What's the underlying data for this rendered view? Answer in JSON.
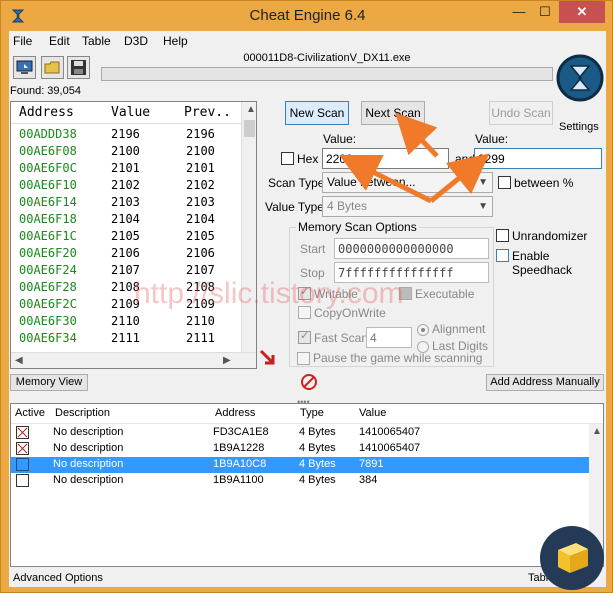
{
  "window": {
    "title": "Cheat Engine 6.4",
    "minimize_glyph": "—",
    "maximize_glyph": "☐",
    "close_glyph": "✕"
  },
  "menu": {
    "items": [
      "File",
      "Edit",
      "Table",
      "D3D",
      "Help"
    ]
  },
  "toolbar": {
    "process_name": "000011D8-CivilizationV_DX11.exe",
    "found": "Found: 39,054",
    "settings_label": "Settings"
  },
  "address_list": {
    "headers": {
      "address": "Address",
      "value": "Value",
      "previous": "Prev.."
    },
    "rows": [
      {
        "address": "00ADDD38",
        "value": "2196",
        "previous": "2196"
      },
      {
        "address": "00AE6F08",
        "value": "2100",
        "previous": "2100"
      },
      {
        "address": "00AE6F0C",
        "value": "2101",
        "previous": "2101"
      },
      {
        "address": "00AE6F10",
        "value": "2102",
        "previous": "2102"
      },
      {
        "address": "00AE6F14",
        "value": "2103",
        "previous": "2103"
      },
      {
        "address": "00AE6F18",
        "value": "2104",
        "previous": "2104"
      },
      {
        "address": "00AE6F1C",
        "value": "2105",
        "previous": "2105"
      },
      {
        "address": "00AE6F20",
        "value": "2106",
        "previous": "2106"
      },
      {
        "address": "00AE6F24",
        "value": "2107",
        "previous": "2107"
      },
      {
        "address": "00AE6F28",
        "value": "2108",
        "previous": "2108"
      },
      {
        "address": "00AE6F2C",
        "value": "2109",
        "previous": "2109"
      },
      {
        "address": "00AE6F30",
        "value": "2110",
        "previous": "2110"
      },
      {
        "address": "00AE6F34",
        "value": "2111",
        "previous": "2111"
      }
    ]
  },
  "scan": {
    "new_scan": "New Scan",
    "next_scan": "Next Scan",
    "undo_scan": "Undo Scan",
    "value_label": "Value:",
    "value2_label": "Value:",
    "hex_label": "Hex",
    "value_from": "2200",
    "and_label": "and",
    "value_to": "2299",
    "scan_type_label": "Scan Type",
    "scan_type": "Value between...",
    "between_pct_label": "between %",
    "value_type_label": "Value Type",
    "value_type": "4 Bytes"
  },
  "memory_options": {
    "title": "Memory Scan Options",
    "start_label": "Start",
    "start_value": "0000000000000000",
    "stop_label": "Stop",
    "stop_value": "7fffffffffffffff",
    "writable_label": "Writable",
    "executable_label": "Executable",
    "copy_on_write_label": "CopyOnWrite",
    "fast_scan_label": "Fast Scan",
    "fast_scan_value": "4",
    "alignment_label": "Alignment",
    "last_digits_label": "Last Digits",
    "pause_label": "Pause the game while scanning"
  },
  "extras": {
    "unrandomizer_label": "Unrandomizer",
    "speedhack_label": "Enable Speedhack"
  },
  "buttons": {
    "memory_view": "Memory View",
    "add_address": "Add Address Manually"
  },
  "watermark": "http://slic.tistory.com",
  "cheat_table": {
    "headers": {
      "active": "Active",
      "description": "Description",
      "address": "Address",
      "type": "Type",
      "value": "Value"
    },
    "rows": [
      {
        "description": "No description",
        "address": "FD3CA1E8",
        "type": "4 Bytes",
        "value": "1410065407",
        "state": "x"
      },
      {
        "description": "No description",
        "address": "1B9A1228",
        "type": "4 Bytes",
        "value": "1410065407",
        "state": "x"
      },
      {
        "description": "No description",
        "address": "1B9A10C8",
        "type": "4 Bytes",
        "value": "7891",
        "state": "selected"
      },
      {
        "description": "No description",
        "address": "1B9A1100",
        "type": "4 Bytes",
        "value": "384",
        "state": "empty"
      }
    ]
  },
  "status": {
    "advanced_options": "Advanced Options",
    "table_extras": "Table"
  },
  "colors": {
    "frame": "#eba843",
    "address_green": "#1a8a1a",
    "selection_blue": "#3399ff",
    "annotation_arrow": "#f07a2a"
  }
}
